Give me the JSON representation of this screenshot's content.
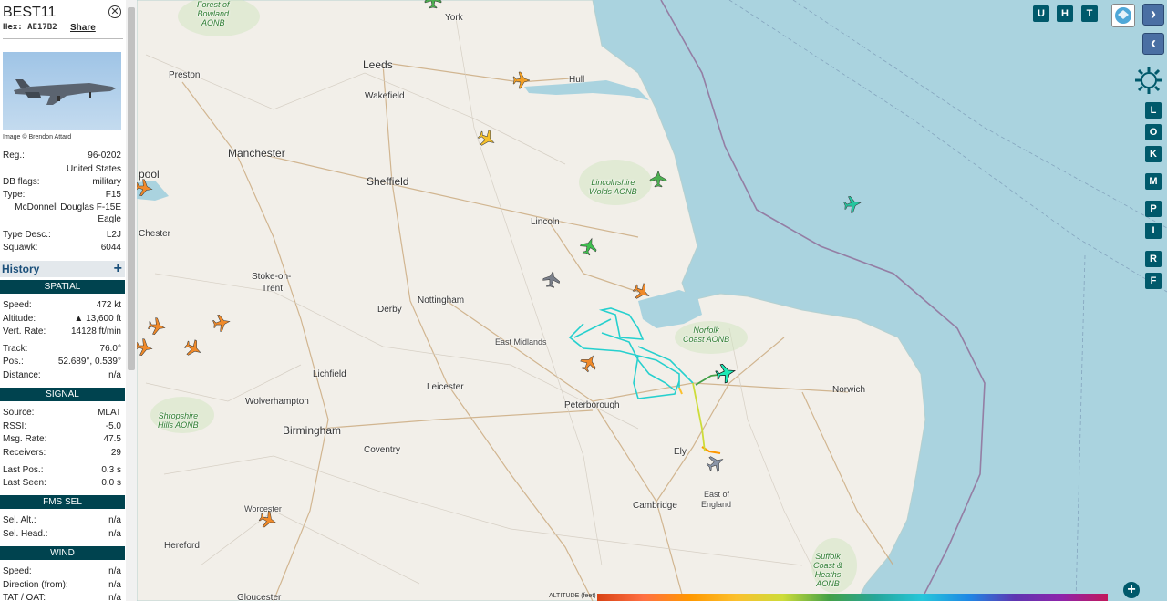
{
  "aircraft": {
    "callsign": "BEST11",
    "hex_label": "Hex:",
    "hex": "AE17B2",
    "share_label": "Share",
    "photo_credit": "Image © Brendon Attard",
    "reg_label": "Reg.:",
    "reg": "96-0202",
    "country": "United States",
    "db_flags_label": "DB flags:",
    "db_flags": "military",
    "type_label": "Type:",
    "type": "F15",
    "type_full_1": "McDonnell Douglas F-15E",
    "type_full_2": "Eagle",
    "type_desc_label": "Type Desc.:",
    "type_desc": "L2J",
    "squawk_label": "Squawk:",
    "squawk": "6044"
  },
  "history": {
    "label": "History",
    "plus": "+"
  },
  "spatial": {
    "header": "SPATIAL",
    "speed_label": "Speed:",
    "speed": "472 kt",
    "altitude_label": "Altitude:",
    "altitude": "▲ 13,600 ft",
    "vert_rate_label": "Vert. Rate:",
    "vert_rate": "14128 ft/min",
    "track_label": "Track:",
    "track": "76.0°",
    "pos_label": "Pos.:",
    "pos": "52.689°, 0.539°",
    "distance_label": "Distance:",
    "distance": "n/a"
  },
  "signal": {
    "header": "SIGNAL",
    "source_label": "Source:",
    "source": "MLAT",
    "rssi_label": "RSSI:",
    "rssi": "-5.0",
    "msg_rate_label": "Msg. Rate:",
    "msg_rate": "47.5",
    "receivers_label": "Receivers:",
    "receivers": "29",
    "last_pos_label": "Last Pos.:",
    "last_pos": "0.3 s",
    "last_seen_label": "Last Seen:",
    "last_seen": "0.0 s"
  },
  "fms": {
    "header": "FMS SEL",
    "sel_alt_label": "Sel. Alt.:",
    "sel_alt": "n/a",
    "sel_head_label": "Sel. Head.:",
    "sel_head": "n/a"
  },
  "wind": {
    "header": "WIND",
    "speed_label": "Speed:",
    "speed": "n/a",
    "direction_label": "Direction (from):",
    "direction": "n/a",
    "tat_label": "TAT / OAT:",
    "tat": "n/a"
  },
  "map": {
    "cities": {
      "york": "York",
      "leeds": "Leeds",
      "hull": "Hull",
      "preston": "Preston",
      "wakefield": "Wakefield",
      "manchester": "Manchester",
      "sheffield": "Sheffield",
      "lincoln": "Lincoln",
      "blackpool": "pool",
      "chester": "Chester",
      "stoke": "Stoke-on-",
      "stoke2": "Trent",
      "derby": "Derby",
      "nottingham": "Nottingham",
      "east_midlands": "East Midlands",
      "lichfield": "Lichfield",
      "leicester": "Leicester",
      "wolverhampton": "Wolverhampton",
      "birmingham": "Birmingham",
      "coventry": "Coventry",
      "peterborough": "Peterborough",
      "norwich": "Norwich",
      "ely": "Ely",
      "cambridge": "Cambridge",
      "east_england_1": "East of",
      "east_england_2": "England",
      "worcester": "Worcester",
      "hereford": "Hereford",
      "gloucester": "Gloucester"
    },
    "aonbs": {
      "bowland_1": "Forest of",
      "bowland_2": "Bowland",
      "bowland_3": "AONB",
      "lincs_1": "Lincolnshire",
      "lincs_2": "Wolds AONB",
      "norfolk_1": "Norfolk",
      "norfolk_2": "Coast AONB",
      "shropshire_1": "Shropshire",
      "shropshire_2": "Hills AONB",
      "suffolk_1": "Suffolk",
      "suffolk_2": "Coast &",
      "suffolk_3": "Heaths",
      "suffolk_4": "AONB"
    },
    "buttons": {
      "u": "U",
      "h": "H",
      "t": "T",
      "next": "›",
      "prev": "‹",
      "l": "L",
      "o": "O",
      "k": "K",
      "m": "M",
      "p": "P",
      "i": "I",
      "r": "R",
      "f": "F",
      "zoom_in": "+"
    },
    "altitude_legend": "ALTITUDE (feet)",
    "colors": {
      "sea": "#aad3df",
      "land": "#f2efe9",
      "track_cyan": "#26d0ce",
      "selected": "#1de9b6"
    }
  }
}
